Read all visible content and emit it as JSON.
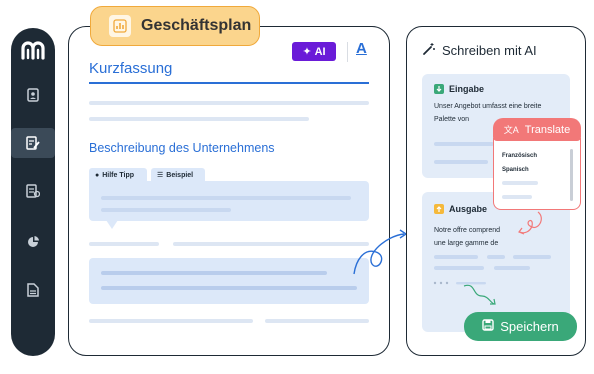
{
  "badge": {
    "title": "Geschäftsplan",
    "icon": "chart-icon"
  },
  "toolbar": {
    "ai_label": "AI",
    "text_style_label": "A"
  },
  "document": {
    "title": "Kurzfassung",
    "section_title": "Beschreibung des Unternehmens",
    "tabs": [
      {
        "label": "Hilfe Tipp",
        "icon": "help-icon"
      },
      {
        "label": "Beispiel",
        "icon": "list-icon"
      }
    ]
  },
  "ai_panel": {
    "title": "Schreiben mit AI",
    "input": {
      "title": "Eingabe",
      "text_line1": "Unser Angebot umfasst eine breite",
      "text_line2": "Palette von"
    },
    "output": {
      "title": "Ausgabe",
      "text_line1": "Notre offre comprend",
      "text_line2": "une large gamme de"
    },
    "translate": {
      "label": "Translate",
      "options": [
        "Französisch",
        "Spanisch"
      ]
    },
    "save_label": "Speichern"
  },
  "sidebar": {
    "items": [
      "logo-icon",
      "contacts-icon",
      "edit-document-icon",
      "document-icon",
      "pie-chart-icon",
      "file-icon"
    ]
  },
  "colors": {
    "sidebar": "#1e2a35",
    "accent_blue": "#2a6fd6",
    "ai_purple": "#6a1bd8",
    "translate_red": "#f27878",
    "save_green": "#3aa879",
    "badge_yellow": "#fbd58d"
  }
}
